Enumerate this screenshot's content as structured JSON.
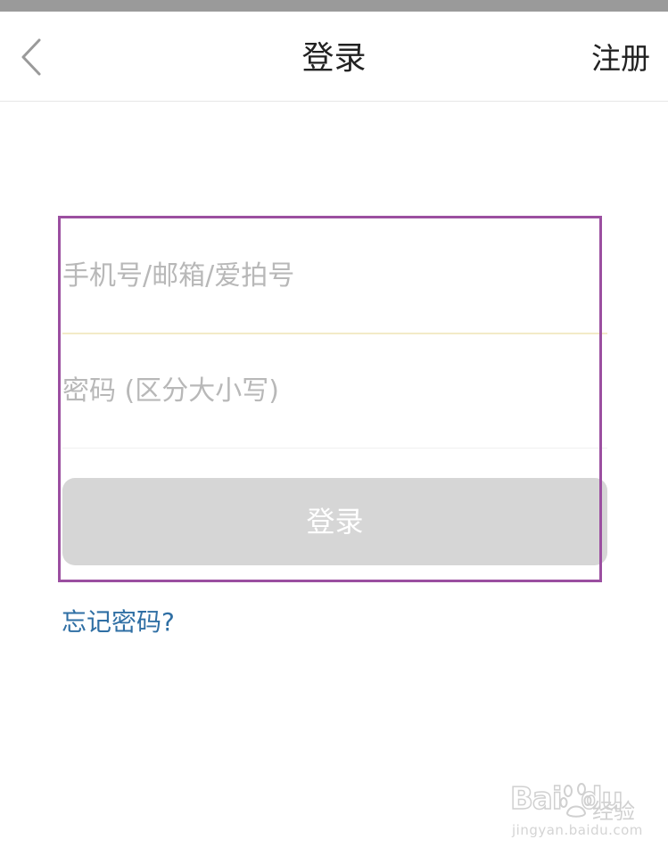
{
  "nav": {
    "back_icon": "chevron-left-icon",
    "title": "登录",
    "register_label": "注册"
  },
  "form": {
    "account_placeholder": "手机号/邮箱/爱拍号",
    "account_value": "",
    "password_placeholder": "密码 (区分大小写)",
    "password_value": "",
    "login_label": "登录",
    "forgot_label": "忘记密码?"
  },
  "colors": {
    "highlight_frame": "#9b4fa0",
    "login_button_disabled": "#d6d6d6",
    "link": "#2f6fa4",
    "placeholder": "#b8b8b8"
  },
  "watermark": {
    "logo": "Bai du 经验",
    "url": "jingyan.baidu.com"
  }
}
